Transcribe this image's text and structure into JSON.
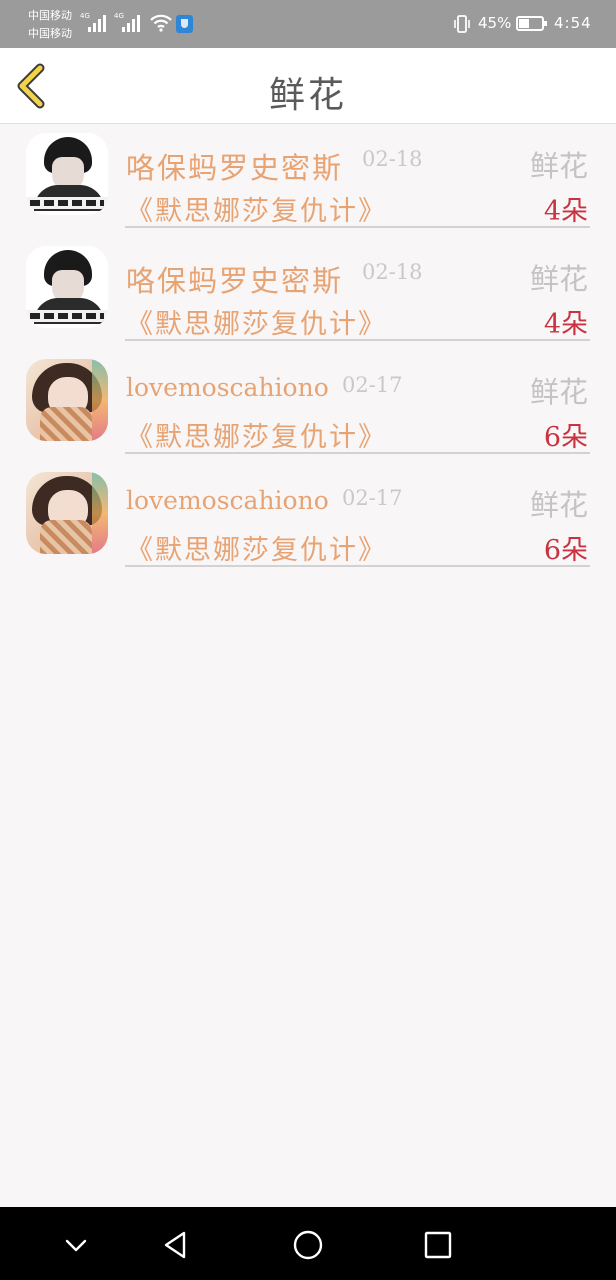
{
  "status_bar": {
    "carrier_1": "中国移动",
    "carrier_2": "中国移动",
    "network_1": "4G",
    "network_2": "4G",
    "battery_percent": "45%",
    "battery_level": 0.45,
    "time": "4:54",
    "icons": [
      "signal-icon",
      "signal-icon",
      "wifi-icon",
      "shield-icon",
      "vibrate-icon",
      "battery-icon"
    ]
  },
  "header": {
    "back_icon": "chevron-left-icon",
    "title": "鲜花"
  },
  "list": [
    {
      "sender": "咯保蚂罗史密斯",
      "date": "02-18",
      "gift": "鲜花",
      "book": "《默思娜莎复仇计》",
      "quantity": "4朵",
      "avatar": "avatar-a"
    },
    {
      "sender": "咯保蚂罗史密斯",
      "date": "02-18",
      "gift": "鲜花",
      "book": "《默思娜莎复仇计》",
      "quantity": "4朵",
      "avatar": "avatar-a"
    },
    {
      "sender": "lovemoscahiono",
      "date": "02-17",
      "gift": "鲜花",
      "book": "《默思娜莎复仇计》",
      "quantity": "6朵",
      "avatar": "avatar-b"
    },
    {
      "sender": "lovemoscahiono",
      "date": "02-17",
      "gift": "鲜花",
      "book": "《默思娜莎复仇计》",
      "quantity": "6朵",
      "avatar": "avatar-b"
    }
  ],
  "nav_bar": {
    "icons": [
      "chevron-down-icon",
      "back-triangle-icon",
      "home-circle-icon",
      "recents-square-icon"
    ]
  },
  "colors": {
    "accent_orange": "#e8a373",
    "quantity_red": "#c9333f",
    "back_yellow": "#f2d449"
  }
}
